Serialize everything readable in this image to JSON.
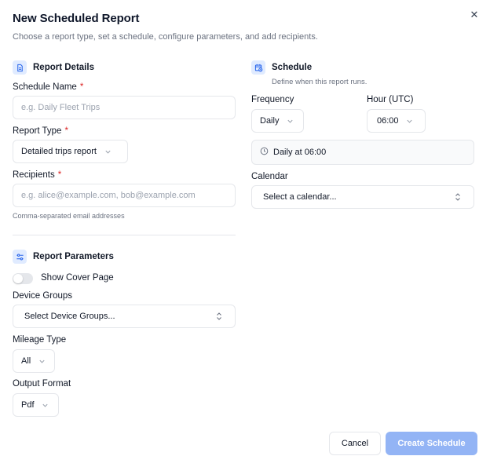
{
  "dialog": {
    "title": "New Scheduled Report",
    "subtitle": "Choose a report type, set a schedule, configure parameters, and add recipients.",
    "close_icon": "close-icon"
  },
  "report_details": {
    "title": "Report Details",
    "icon": "document-icon",
    "schedule_name": {
      "label": "Schedule Name",
      "required": "*",
      "placeholder": "e.g. Daily Fleet Trips",
      "value": ""
    },
    "report_type": {
      "label": "Report Type",
      "required": "*",
      "value": "Detailed trips report"
    },
    "recipients": {
      "label": "Recipients",
      "required": "*",
      "placeholder": "e.g. alice@example.com, bob@example.com",
      "help": "Comma-separated email addresses"
    }
  },
  "report_parameters": {
    "title": "Report Parameters",
    "icon": "sliders-icon",
    "cover_page": {
      "label": "Show Cover Page",
      "enabled": false
    },
    "device_groups": {
      "label": "Device Groups",
      "value": "Select Device Groups..."
    },
    "mileage_type": {
      "label": "Mileage Type",
      "value": "All"
    },
    "output_format": {
      "label": "Output Format",
      "value": "Pdf"
    }
  },
  "schedule": {
    "title": "Schedule",
    "icon": "calendar-clock-icon",
    "subtitle": "Define when this report runs.",
    "frequency": {
      "label": "Frequency",
      "value": "Daily"
    },
    "hour": {
      "label": "Hour (UTC)",
      "value": "06:00"
    },
    "summary": "Daily at 06:00",
    "calendar": {
      "label": "Calendar",
      "value": "Select a calendar..."
    }
  },
  "actions": {
    "cancel": "Cancel",
    "create": "Create Schedule"
  },
  "colors": {
    "accent": "#93b4f5",
    "required": "#dc2626",
    "icon_bg": "#e0ebff"
  }
}
